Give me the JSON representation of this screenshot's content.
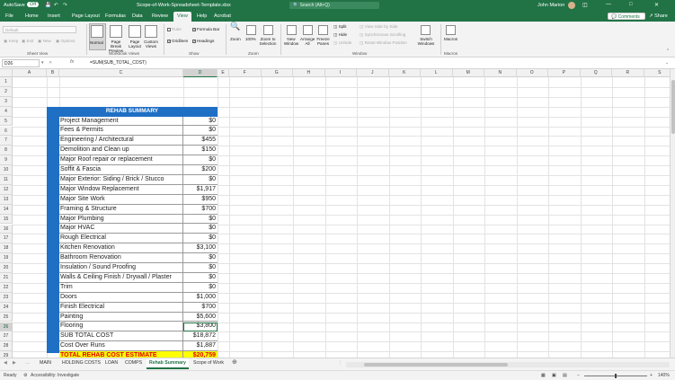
{
  "window": {
    "autosave_label": "AutoSave",
    "autosave_state": "Off",
    "title": "Scope-of-Work-Spreadsheet-Template.xlsx",
    "search_placeholder": "Search (Alt+Q)",
    "user_name": "John Marion"
  },
  "ribbon_tabs": [
    "File",
    "Home",
    "Insert",
    "Page Layout",
    "Formulas",
    "Data",
    "Review",
    "View",
    "Help",
    "Acrobat"
  ],
  "active_tab": "View",
  "header_buttons": {
    "comments": "Comments",
    "share": "Share"
  },
  "ribbon": {
    "sheet_view": {
      "label": "Sheet View",
      "dropdown": "Default",
      "keep": "Keep",
      "exit": "Exit",
      "new": "New",
      "options": "Options"
    },
    "workbook_views": {
      "label": "Workbook Views",
      "normal": "Normal",
      "page_break_preview": "Page Break Preview",
      "page_layout": "Page Layout",
      "custom_views": "Custom Views"
    },
    "show": {
      "label": "Show",
      "ruler": "Ruler",
      "formula_bar": "Formula Bar",
      "gridlines": "Gridlines",
      "headings": "Headings"
    },
    "zoom": {
      "label": "Zoom",
      "zoom": "Zoom",
      "hundred": "100%",
      "zoom_to_selection": "Zoom to Selection"
    },
    "window": {
      "label": "Window",
      "new_window": "New Window",
      "arrange_all": "Arrange All",
      "freeze_panes": "Freeze Panes",
      "split": "Split",
      "hide": "Hide",
      "unhide": "Unhide",
      "view_side_by_side": "View Side by Side",
      "synchronous_scrolling": "Synchronous Scrolling",
      "reset_window_position": "Reset Window Position",
      "switch_windows": "Switch Windows"
    },
    "macros": {
      "label": "Macros",
      "macros": "Macros"
    }
  },
  "formula_bar": {
    "name_box": "D26",
    "fx": "fx",
    "formula": "=SUM(SUB_TOTAL_COST)"
  },
  "columns": [
    "A",
    "B",
    "C",
    "D",
    "E",
    "F",
    "G",
    "H",
    "I",
    "J",
    "K",
    "L",
    "M",
    "N",
    "O",
    "P",
    "Q",
    "R",
    "S"
  ],
  "rows": [
    "1",
    "2",
    "3",
    "4",
    "5",
    "6",
    "7",
    "8",
    "9",
    "10",
    "11",
    "12",
    "13",
    "14",
    "15",
    "16",
    "17",
    "18",
    "19",
    "20",
    "21",
    "22",
    "23",
    "24",
    "25",
    "26",
    "27",
    "28",
    "29"
  ],
  "selected_cell": "D26",
  "summary": {
    "title": "REHAB SUMMARY",
    "rows": [
      {
        "label": "Project Management",
        "value": "$0"
      },
      {
        "label": "Fees & Permits",
        "value": "$0"
      },
      {
        "label": "Engineering / Architectural",
        "value": "$455"
      },
      {
        "label": "Demolition and Clean up",
        "value": "$150"
      },
      {
        "label": "Major Roof repair or replacement",
        "value": "$0"
      },
      {
        "label": "Soffit & Fascia",
        "value": "$200"
      },
      {
        "label": "Major Exterior: Siding / Brick / Stucco",
        "value": "$0"
      },
      {
        "label": "Major Window Replacement",
        "value": "$1,917"
      },
      {
        "label": "Major Site Work",
        "value": "$950"
      },
      {
        "label": "Framing & Structure",
        "value": "$700"
      },
      {
        "label": "Major Plumbing",
        "value": "$0"
      },
      {
        "label": "Major HVAC",
        "value": "$0"
      },
      {
        "label": "Rough Electrical",
        "value": "$0"
      },
      {
        "label": "Kitchen Renovation",
        "value": "$3,100"
      },
      {
        "label": "Bathroom Renovation",
        "value": "$0"
      },
      {
        "label": "Insulation / Sound Proofing",
        "value": "$0"
      },
      {
        "label": "Walls & Ceiling Finish / Drywall / Plaster",
        "value": "$0"
      },
      {
        "label": "Trim",
        "value": "$0"
      },
      {
        "label": "Doors",
        "value": "$1,000"
      },
      {
        "label": "Finish Electrical",
        "value": "$700"
      },
      {
        "label": "Painting",
        "value": "$5,600"
      },
      {
        "label": "Flooring",
        "value": "$3,800"
      },
      {
        "label": "SUB TOTAL COST",
        "value": "$18,872"
      },
      {
        "label": "Cost Over Runs",
        "value": "$1,887"
      },
      {
        "label": "TOTAL REHAB COST ESTIMATE",
        "value": "$20,759"
      }
    ]
  },
  "sheet_tabs": [
    "MAIN",
    "HOLDING COSTS",
    "LOAN",
    "COMPS",
    "Rehab Summary",
    "Scope of Work"
  ],
  "active_sheet": "Rehab Summary",
  "status": {
    "ready": "Ready",
    "accessibility": "Accessibility: Investigate",
    "zoom": "140%"
  }
}
